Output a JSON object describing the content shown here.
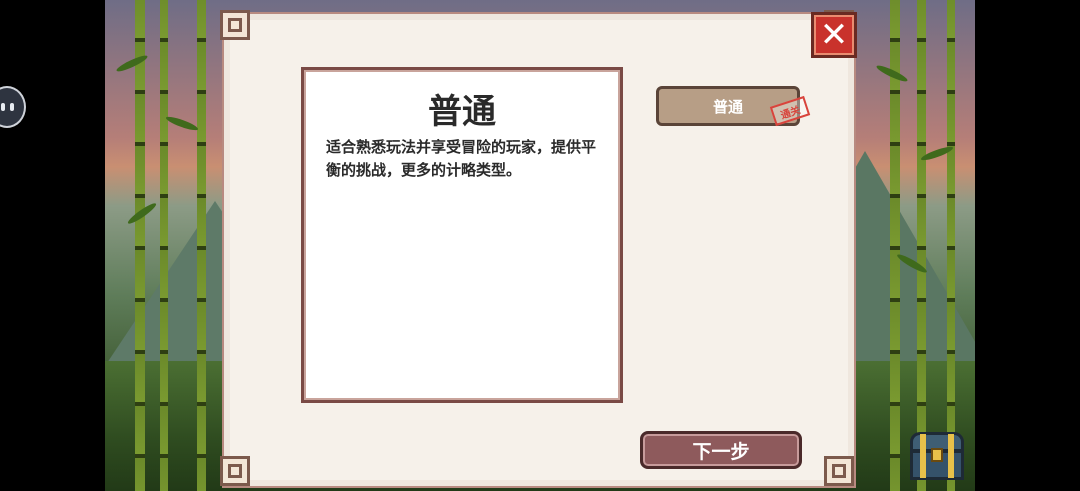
{
  "close_button": {
    "icon": "close-icon",
    "glyph": "✕",
    "color": "#c9322c"
  },
  "info_panel": {
    "title": "普通",
    "description": "适合熟悉玩法并享受冒险的玩家，提供平衡的挑战，更多的计略类型。"
  },
  "difficulty_option": {
    "label": "普通",
    "stamp": "通关"
  },
  "next_button": {
    "label": "下一步"
  },
  "side_icon": {
    "icon": "floating-assistant-icon"
  },
  "chest_icon": {
    "icon": "treasure-chest-icon"
  },
  "colors": {
    "dialog_bg": "#f6f1ea",
    "frame": "#7a4a45",
    "mode_button": "#b79e86",
    "next_button": "#8e5a5c",
    "stamp": "#d8443c"
  }
}
